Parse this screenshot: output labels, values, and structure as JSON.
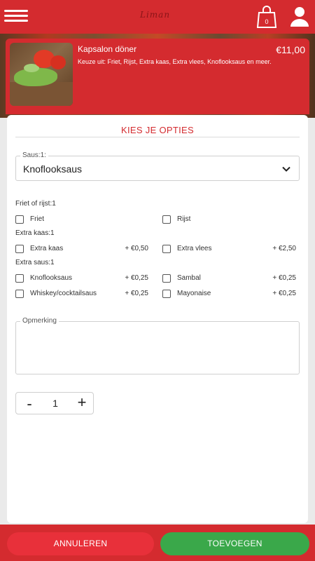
{
  "topbar": {
    "logo_text": "Liman",
    "cart_count": "0",
    "icons": [
      "menu-icon",
      "shopping-bag-icon",
      "user-icon"
    ]
  },
  "item": {
    "title": "Kapsalon döner",
    "price": "€11,00",
    "description": "Keuze uit: Friet, Rijst, Extra kaas, Extra vlees, Knoflooksaus en meer."
  },
  "options": {
    "title": "KIES JE OPTIES",
    "sauce_select": {
      "label": "Saus:1:",
      "value": "Knoflooksaus"
    },
    "groups": [
      {
        "label": "Friet of rijst:1",
        "options": [
          {
            "label": "Friet",
            "price": "",
            "checked": false
          },
          {
            "label": "Rijst",
            "price": "",
            "checked": false
          }
        ]
      },
      {
        "label": "Extra kaas:1",
        "options": [
          {
            "label": "Extra kaas",
            "price": "+ €0,50",
            "checked": false
          },
          {
            "label": "Extra vlees",
            "price": "+ €2,50",
            "checked": false
          }
        ]
      },
      {
        "label": "Extra saus:1",
        "options": [
          {
            "label": "Knoflooksaus",
            "price": "+ €0,25",
            "checked": false
          },
          {
            "label": "Sambal",
            "price": "+ €0,25",
            "checked": false
          },
          {
            "label": "Whiskey/cocktailsaus",
            "price": "+ €0,25",
            "checked": false
          },
          {
            "label": "Mayonaise",
            "price": "+ €0,25",
            "checked": false
          }
        ]
      }
    ],
    "remark": {
      "label": "Opmerking",
      "value": ""
    },
    "quantity": {
      "minus": "-",
      "value": "1",
      "plus": "+"
    }
  },
  "footer": {
    "cancel_label": "ANNULEREN",
    "add_label": "TOEVOEGEN"
  },
  "colors": {
    "brand_red": "#d42b2f",
    "cancel_red": "#e8303a",
    "add_green": "#3aa84a"
  }
}
